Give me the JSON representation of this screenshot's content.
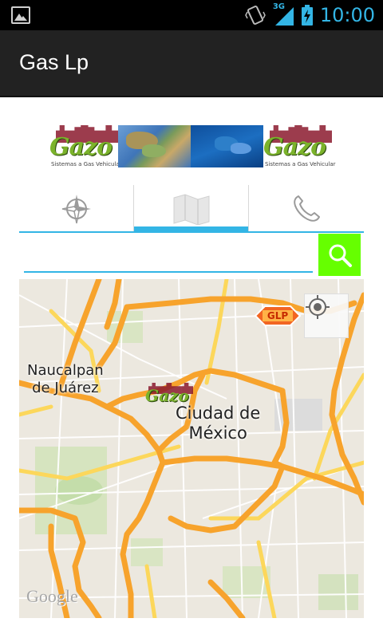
{
  "status_bar": {
    "time": "10:00",
    "network": "3G",
    "icons": [
      "image-notification-icon",
      "vibrate-icon",
      "signal-3g-icon",
      "battery-charging-icon"
    ]
  },
  "action_bar": {
    "title": "Gas Lp"
  },
  "banner": {
    "logo_text": "Gazo",
    "logo_subtitle": "Sistemas a Gas Vehicular"
  },
  "tabs": [
    {
      "name": "compass",
      "icon": "compass-icon",
      "selected": false
    },
    {
      "name": "map",
      "icon": "map-icon",
      "selected": true
    },
    {
      "name": "phone",
      "icon": "phone-icon",
      "selected": false
    }
  ],
  "search": {
    "value": "",
    "placeholder": "",
    "button_icon": "search-icon"
  },
  "map": {
    "labels": {
      "naucalpan": "Naucalpan\nde Juárez",
      "cdmx": "Ciudad de\nMéxico"
    },
    "markers": {
      "glp": "GLP",
      "gazo": "Gazo"
    },
    "attribution": "Google",
    "locate_icon": "my-location-icon"
  },
  "colors": {
    "accent": "#33b5e5",
    "search_button": "#66ff00",
    "action_bar": "#222222",
    "road_major": "#f7a32c",
    "road_minor": "#fcd75b"
  }
}
